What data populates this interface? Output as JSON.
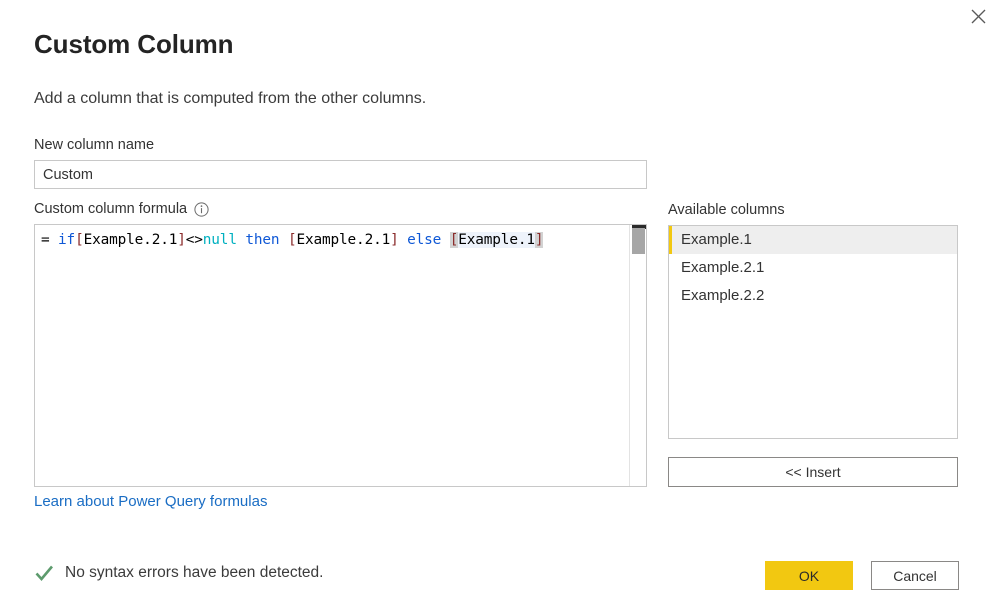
{
  "dialog": {
    "title": "Custom Column",
    "subtitle": "Add a column that is computed from the other columns.",
    "close_icon": "close-icon"
  },
  "new_column": {
    "label": "New column name",
    "value": "Custom",
    "placeholder": "New column name"
  },
  "formula": {
    "label": "Custom column formula",
    "info_icon": "info-circle-icon",
    "text": "= if[Example.2.1]<>null then [Example.2.1] else [Example.1]",
    "tokens": [
      {
        "t": "= ",
        "k": "plain"
      },
      {
        "t": "if",
        "k": "keyword"
      },
      {
        "t": "[",
        "k": "bracket"
      },
      {
        "t": "Example.2.1",
        "k": "ident"
      },
      {
        "t": "]",
        "k": "bracket"
      },
      {
        "t": "<>",
        "k": "plain"
      },
      {
        "t": "null",
        "k": "const"
      },
      {
        "t": " ",
        "k": "plain"
      },
      {
        "t": "then",
        "k": "keyword"
      },
      {
        "t": " ",
        "k": "plain"
      },
      {
        "t": "[",
        "k": "bracket"
      },
      {
        "t": "Example.2.1",
        "k": "ident"
      },
      {
        "t": "]",
        "k": "bracket"
      },
      {
        "t": " ",
        "k": "plain"
      },
      {
        "t": "else",
        "k": "keyword"
      },
      {
        "t": " ",
        "k": "plain"
      },
      {
        "t": "[",
        "k": "match-bracket"
      },
      {
        "t": "Example.1",
        "k": "match-ident"
      },
      {
        "t": "]",
        "k": "match-bracket"
      }
    ],
    "scrollbar": "vertical-scrollbar"
  },
  "learn_link": {
    "text": "Learn about Power Query formulas"
  },
  "available_columns": {
    "label": "Available columns",
    "items": [
      {
        "label": "Example.1",
        "selected": true
      },
      {
        "label": "Example.2.1",
        "selected": false
      },
      {
        "label": "Example.2.2",
        "selected": false
      }
    ]
  },
  "insert_button": {
    "label": "<< Insert"
  },
  "status": {
    "icon": "checkmark-icon",
    "text": "No syntax errors have been detected."
  },
  "footer": {
    "ok_label": "OK",
    "cancel_label": "Cancel"
  },
  "colors": {
    "accent_yellow": "#F2C811",
    "link_blue": "#1A6DC4",
    "success_green": "#5D9B6D",
    "keyword_blue": "#0F58D6",
    "constant_cyan": "#00B0C0",
    "bracket_maroon": "#8B2C2C",
    "border_gray": "#C8C8C8",
    "selected_row": "#EEEEEE"
  }
}
